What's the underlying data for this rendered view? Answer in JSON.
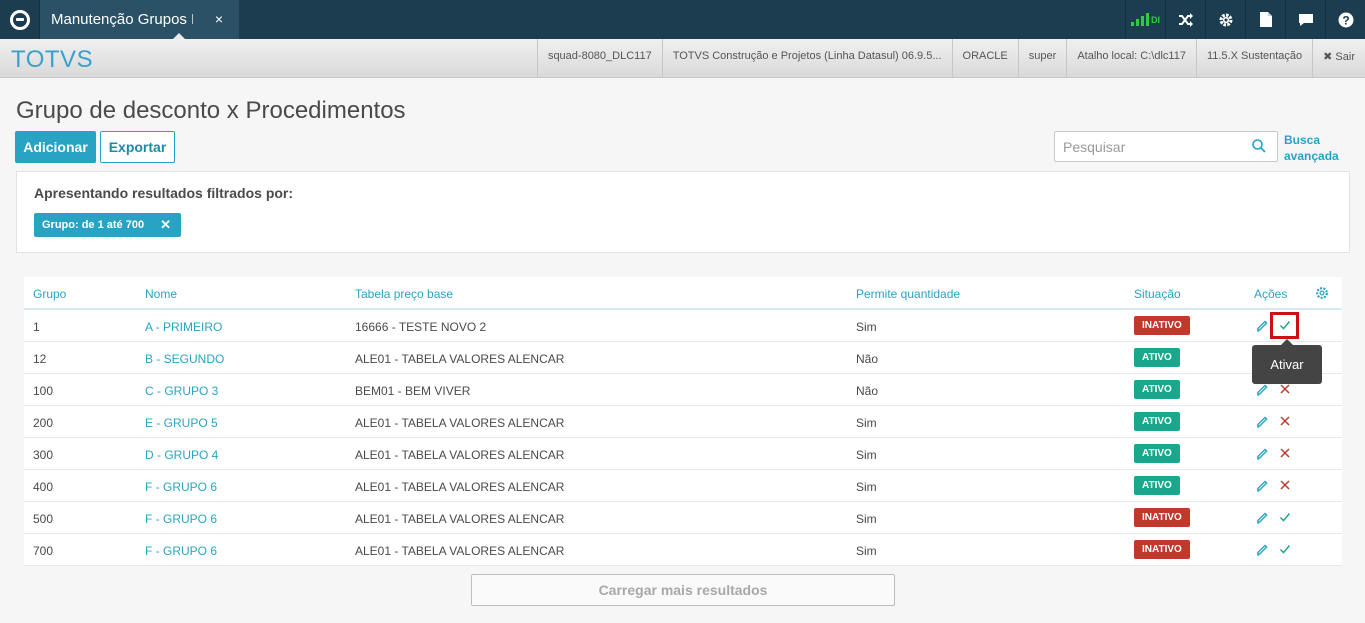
{
  "topbar": {
    "tab_title": "Manutenção Grupos D",
    "tab_close": "×",
    "status_label": "DI",
    "icons": [
      "connection-status-icon",
      "shuffle-icon",
      "gear-icon",
      "document-icon",
      "chat-icon",
      "help-icon"
    ]
  },
  "infobar": {
    "brand": "TOTVS",
    "items": [
      "squad-8080_DLC117",
      "TOTVS Construção e Projetos (Linha Datasul) 06.9.5...",
      "ORACLE",
      "super",
      "Atalho local: C:\\dlc117",
      "11.5.X Sustentação",
      "✖ Sair"
    ]
  },
  "page": {
    "title": "Grupo de desconto x Procedimentos",
    "add_label": "Adicionar",
    "export_label": "Exportar",
    "search_placeholder": "Pesquisar",
    "adv_search_line1": "Busca",
    "adv_search_line2": "avançada"
  },
  "filter": {
    "label": "Apresentando resultados filtrados por:",
    "chip": "Grupo: de 1 até 700",
    "chip_close": "✕"
  },
  "table": {
    "headers": {
      "grupo": "Grupo",
      "nome": "Nome",
      "tabela": "Tabela preço base",
      "permite": "Permite quantidade",
      "situacao": "Situação",
      "acoes": "Ações"
    },
    "rows": [
      {
        "grupo": "1",
        "nome": "A - PRIMEIRO",
        "tabela": "16666 - TESTE NOVO 2",
        "permite": "Sim",
        "situacao": "INATIVO",
        "status": "inactive"
      },
      {
        "grupo": "12",
        "nome": "B - SEGUNDO",
        "tabela": "ALE01 - TABELA VALORES ALENCAR",
        "permite": "Não",
        "situacao": "ATIVO",
        "status": "active"
      },
      {
        "grupo": "100",
        "nome": "C - GRUPO 3",
        "tabela": "BEM01 - BEM VIVER",
        "permite": "Não",
        "situacao": "ATIVO",
        "status": "active"
      },
      {
        "grupo": "200",
        "nome": "E - GRUPO 5",
        "tabela": "ALE01 - TABELA VALORES ALENCAR",
        "permite": "Sim",
        "situacao": "ATIVO",
        "status": "active"
      },
      {
        "grupo": "300",
        "nome": "D - GRUPO 4",
        "tabela": "ALE01 - TABELA VALORES ALENCAR",
        "permite": "Sim",
        "situacao": "ATIVO",
        "status": "active"
      },
      {
        "grupo": "400",
        "nome": "F - GRUPO 6",
        "tabela": "ALE01 - TABELA VALORES ALENCAR",
        "permite": "Sim",
        "situacao": "ATIVO",
        "status": "active"
      },
      {
        "grupo": "500",
        "nome": "F - GRUPO 6",
        "tabela": "ALE01 - TABELA VALORES ALENCAR",
        "permite": "Sim",
        "situacao": "INATIVO",
        "status": "inactive"
      },
      {
        "grupo": "700",
        "nome": "F - GRUPO 6",
        "tabela": "ALE01 - TABELA VALORES ALENCAR",
        "permite": "Sim",
        "situacao": "INATIVO",
        "status": "inactive"
      }
    ]
  },
  "tooltip": "Ativar",
  "load_more": "Carregar mais resultados",
  "colors": {
    "accent": "#29a3c4",
    "active": "#1aa88c",
    "inactive": "#c0392b",
    "topbar": "#1c3d4f"
  }
}
